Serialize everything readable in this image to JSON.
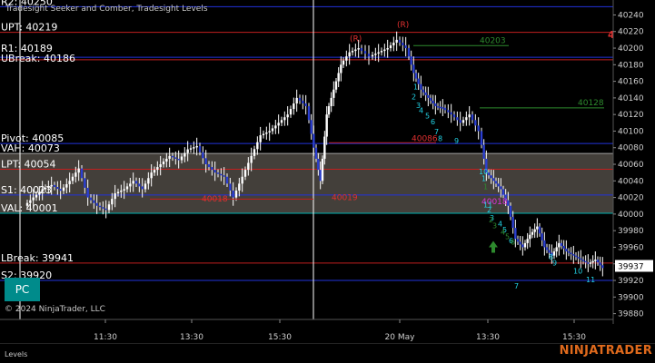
{
  "indicator": {
    "title": "Tradesight Seeker and Comber, Tradesight Levels"
  },
  "levels": [
    {
      "name": "R2",
      "text": "R2: 40250",
      "value": 40250,
      "color": "#2233dd"
    },
    {
      "name": "UPT",
      "text": "UPT: 40219",
      "value": 40219,
      "color": "#c21f1f"
    },
    {
      "name": "R1",
      "text": "R1: 40189",
      "value": 40189,
      "color": "#2233dd"
    },
    {
      "name": "LBreak",
      "text": "UBreak: 40186",
      "value": 40186,
      "color": "#c21f1f"
    },
    {
      "name": "Pivot",
      "text": "Pivot: 40085",
      "value": 40085,
      "color": "#2233dd"
    },
    {
      "name": "VAH",
      "text": "VAH: 40073",
      "value": 40073,
      "color": "#a0a0a0"
    },
    {
      "name": "LPT",
      "text": "LPT: 40054",
      "value": 40054,
      "color": "#c21f1f"
    },
    {
      "name": "S1",
      "text": "S1: 40023",
      "value": 40023,
      "color": "#2233dd"
    },
    {
      "name": "VAL",
      "text": "VAL: 40001",
      "value": 40001,
      "color": "#00b0b0"
    },
    {
      "name": "LBreak2",
      "text": "LBreak: 39941",
      "value": 39941,
      "color": "#c21f1f"
    },
    {
      "name": "S2",
      "text": "S2: 39920",
      "value": 39920,
      "color": "#2233dd"
    }
  ],
  "value_area": {
    "high": 40073,
    "low": 40001,
    "color": "#4a4640"
  },
  "price_axis": {
    "ticks": [
      40240,
      40220,
      40200,
      40180,
      40160,
      40140,
      40120,
      40100,
      40080,
      40060,
      40040,
      40020,
      40000,
      39980,
      39960,
      39940,
      39920,
      39900,
      39880
    ],
    "min": 39873,
    "max": 40258,
    "last_price": "39937",
    "ticks_text": [
      "40240",
      "40220",
      "40200",
      "40180",
      "40160",
      "40140",
      "40120",
      "40100",
      "40080",
      "40060",
      "40040",
      "40020",
      "40000",
      "39980",
      "39960",
      "39940",
      "39920",
      "39900",
      "39880"
    ]
  },
  "time_axis": {
    "labels": [
      "11:30",
      "13:30",
      "15:30",
      "20 May",
      "13:30",
      "15:30"
    ]
  },
  "annotations": {
    "reversal_marks": [
      "(R)",
      "(R)"
    ],
    "red_number": "4",
    "green_levels": [
      "40203",
      "40128"
    ],
    "red_levels": [
      "40018",
      "40019",
      "40086"
    ],
    "magenta_level": "40018",
    "count_labels": [
      "1",
      "2",
      "3",
      "4",
      "5",
      "6",
      "7",
      "8",
      "9",
      "10",
      "11",
      "7",
      "8",
      "9",
      "10",
      "11",
      "1",
      "2",
      "3",
      "4",
      "5",
      "6",
      "1",
      "2",
      "3",
      "4",
      "5",
      "6"
    ]
  },
  "pc_button": {
    "label": "PC"
  },
  "footer": {
    "copyright": "© 2024 NinjaTrader, LLC",
    "tab": "Levels",
    "brand": "NINJATRADER"
  },
  "colors": {
    "candle": "#ffffff",
    "candle_down": "#2b3fd1",
    "background": "#000000",
    "up_arrow": "#2d8a2d"
  }
}
